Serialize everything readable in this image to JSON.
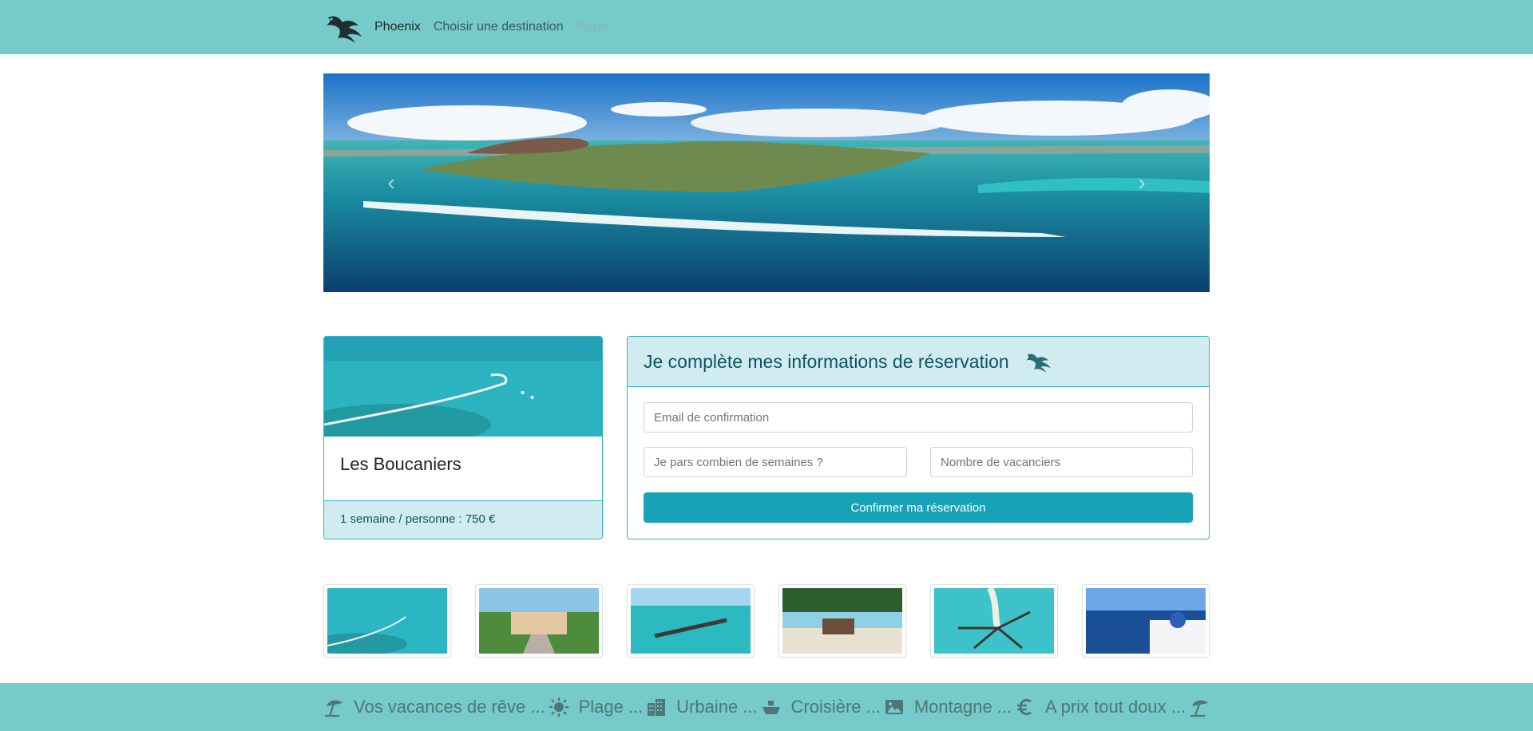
{
  "nav": {
    "brand": "Phoenix",
    "links": [
      "Choisir une destination",
      "Payer"
    ]
  },
  "carousel": {
    "prev_icon": "chevron-left-icon",
    "next_icon": "chevron-right-icon"
  },
  "destination_card": {
    "title": "Les Boucaniers",
    "price": "1 semaine / personne : 750 €"
  },
  "form": {
    "title": "Je complète mes informations de réservation",
    "email_placeholder": "Email de confirmation",
    "weeks_placeholder": "Je pars combien de semaines ?",
    "people_placeholder": "Nombre de vacanciers",
    "submit_label": "Confirmer ma réservation"
  },
  "thumbnails": [
    "lagoon-thumb",
    "bungalows-thumb",
    "overwater-villas-thumb",
    "beach-cabana-thumb",
    "atoll-villas-thumb",
    "santorini-thumb"
  ],
  "footer": {
    "items": [
      "Vos vacances de rêve ...",
      "Plage ...",
      "Urbaine ...",
      "Croisière ...",
      "Montagne ...",
      "A prix tout doux ..."
    ]
  },
  "colors": {
    "navbar": "#76cac9",
    "accent": "#17a2b8",
    "info_bg": "#d1ecf1",
    "info_text": "#0c5460"
  }
}
